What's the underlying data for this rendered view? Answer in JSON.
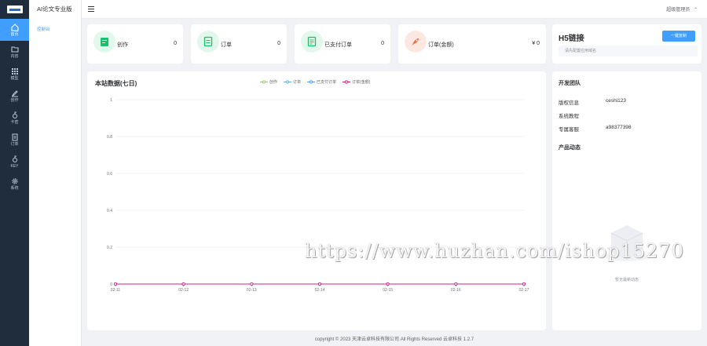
{
  "rail": [
    {
      "label": "首页",
      "icon": "home-icon",
      "active": true
    },
    {
      "label": "内容",
      "icon": "folder-icon"
    },
    {
      "label": "模型",
      "icon": "grid-icon"
    },
    {
      "label": "创作",
      "icon": "pen-icon"
    },
    {
      "label": "卡密",
      "icon": "key-icon"
    },
    {
      "label": "订单",
      "icon": "document-icon"
    },
    {
      "label": "KEY",
      "icon": "key-icon"
    },
    {
      "label": "系统",
      "icon": "gear-icon"
    }
  ],
  "subnav": {
    "brand": "AI论文专业版",
    "item": "控制台"
  },
  "topbar": {
    "admin": "超级管理员"
  },
  "stats": [
    {
      "label": "创作",
      "value": "0",
      "icon": "create-icon",
      "color": "#1fbe6b",
      "bg": "#e3f7ec"
    },
    {
      "label": "订单",
      "value": "0",
      "icon": "order-icon",
      "color": "#1fbe6b",
      "bg": "#e3f7ec"
    },
    {
      "label": "已支付订单",
      "value": "0",
      "icon": "paid-order-icon",
      "color": "#1fbe6b",
      "bg": "#e3f7ec"
    },
    {
      "label": "订单(金额)",
      "value": "¥ 0",
      "icon": "rocket-icon",
      "color": "#f26a3c",
      "bg": "#fde8e1"
    }
  ],
  "h5": {
    "title": "H5链接",
    "button": "一键复制",
    "placeholder": "请先配置应用域名"
  },
  "chart_data": {
    "type": "line",
    "title": "本站数据(七日)",
    "categories": [
      "02-11",
      "02-12",
      "02-13",
      "02-14",
      "02-15",
      "02-16",
      "02-17"
    ],
    "series": [
      {
        "name": "创作",
        "color": "#91cc75",
        "values": [
          0,
          0,
          0,
          0,
          0,
          0,
          0
        ]
      },
      {
        "name": "订单",
        "color": "#5ab1ef",
        "values": [
          0,
          0,
          0,
          0,
          0,
          0,
          0
        ]
      },
      {
        "name": "已支付订单",
        "color": "#409eff",
        "values": [
          0,
          0,
          0,
          0,
          0,
          0,
          0
        ]
      },
      {
        "name": "订单(金额)",
        "color": "#d81b8c",
        "values": [
          0,
          0,
          0,
          0,
          0,
          0,
          0
        ]
      }
    ],
    "ylim": [
      0,
      1
    ],
    "yticks": [
      "1",
      "0.8",
      "0.6",
      "0.4",
      "0.2",
      "0"
    ]
  },
  "team": {
    "title": "开发团队",
    "rows": [
      {
        "k": "版权信息",
        "v": "ceshi123"
      },
      {
        "k": "系统教程",
        "v": ""
      },
      {
        "k": "专属客服",
        "v": "a98377398"
      }
    ],
    "sub": "产品动态",
    "empty": "暂无最新动态"
  },
  "footer": "copyright © 2023    天津云卓科技有限公司 All Rights Reserved    云卓科技 1.2.7",
  "watermark": "https://www.huzhan.com/ishop15270"
}
